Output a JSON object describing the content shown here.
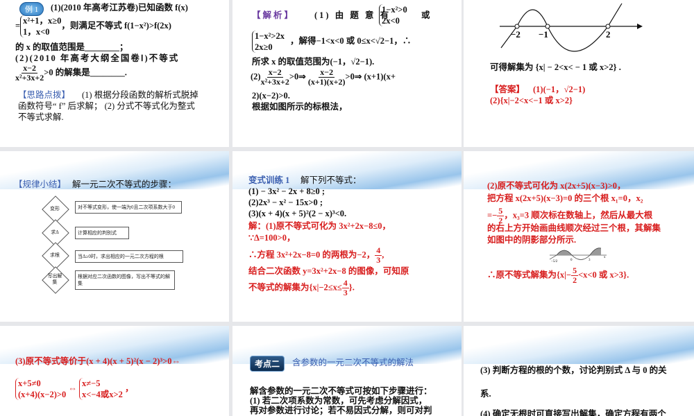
{
  "s1": {
    "badge": "例 1",
    "l1": "(1)(2010 年高考江苏卷)已知函数 f(x)",
    "eq": "=",
    "c1": "x²+1，x≥0",
    "c2": "1，x<0",
    "l2": "，则满足不等式 f(1−x²)>f(2x)",
    "l3": "的 x 的取值范围是________；",
    "l4": "(2)(2010 年高考大纲全国卷Ⅰ)不等式",
    "num": "x−2",
    "den": "x²+3x+2",
    "l5": ">0 的解集是________.",
    "tip": "【思路点拨】",
    "t1": "(1) 根据分段函数的解析式脱掉",
    "t2": "函数符号“ f” 后求解； (2) 分式不等式化为整式",
    "t3": "不等式求解."
  },
  "s2": {
    "tag": "【解析】",
    "l1": "(1) 由 题 意 有",
    "c1": "1−x²>0",
    "c2": "2x<0",
    "or": "或",
    "c3": "1−x²>2x",
    "c4": "2x≥0",
    "l2": "，解得−1<x<0 或 0≤x<√2−1，∴",
    "l3": "所求 x 的取值范围为(−1，√2−1).",
    "p2": "(2)",
    "n1": "x−2",
    "d1": "x²+3x+2",
    "a1": ">0⇒",
    "n2": "x−2",
    "d2": "(x+1)(x+2)",
    "a2": ">0⇒ (x+1)(x+",
    "l4": "2)(x−2)>0.",
    "l5": "根据如图所示的标根法，"
  },
  "s3": {
    "ticks": [
      "−2",
      "−1",
      "2"
    ],
    "l1": "可得解集为 {x| − 2<x< − 1 或 x>2} .",
    "ans": "【答案】",
    "a1": "(1)(−1，√2−1)",
    "a2": "(2){x|−2<x<−1 或 x>2}"
  },
  "s4": {
    "tag": "【规律小结】",
    "title": "解一元二次不等式的步骤：",
    "steps": [
      {
        "d": "变形",
        "b": "对不等式变形，使一端为0且二次项系数大于0"
      },
      {
        "d": "求Δ",
        "b": "计算相应的判别式"
      },
      {
        "d": "求根",
        "b": "当Δ≥0时，求出相应的一元二次方程的根"
      },
      {
        "d": "写出解集",
        "b": "根据对应二次函数的图像，写出不等式的解集"
      }
    ]
  },
  "s5": {
    "tag": "变式训练 1",
    "title": "解下列不等式：",
    "q1": "(1) − 3x² − 2x + 8≥0 ;",
    "q2": "(2)2x³ − x² − 15x>0 ;",
    "q3": "(3)(x + 4)(x + 5)²(2 − x)³<0.",
    "r1": "解：(1)原不等式可化为 3x²+2x−8≤0，",
    "r2": "∵Δ=100>0，",
    "r3": "∴方程 3x²+2x−8=0 的两根为−2，",
    "r3n": "4",
    "r3d": "3",
    "r4": "结合二次函数 y=3x²+2x−8 的图像，可知原",
    "r5": "不等式的解集为{x|−2≤x≤",
    "r5n": "4",
    "r5d": "3",
    "r5e": "}."
  },
  "s6": {
    "l1": "(2)原不等式可化为 x(2x+5)(x−3)>0，",
    "l2": "把方程 x(2x+5)(x−3)=0 的三个根 x₁=0，x₂",
    "l3a": "=−",
    "fn": "5",
    "fd": "2",
    "l3b": "，x₃=3 顺次标在数轴上，然后从最大根",
    "l4": "的右上方开始画曲线顺次经过三个根，其解集",
    "l5": "如图中的阴影部分所示.",
    "ticks": [
      "−5/2",
      "0",
      "3",
      "x"
    ],
    "l6": "∴原不等式解集为{x|−",
    "l6n": "5",
    "l6d": "2",
    "l6e": "<x<0 或 x>3}."
  },
  "s7": {
    "l1": "(3)原不等式等价于(x + 4)(x + 5)²(x − 2)³>0⇔",
    "c1": "x+5≠0",
    "c2": "(x+4)(x−2)>0",
    "iff": "⇔",
    "c3": "x≠−5",
    "c4": "x<−4或x>2",
    "comma": "，"
  },
  "s8": {
    "badge": "考点二",
    "title": "含参数的一元二次不等式的解法",
    "l1": "解含参数的一元二次不等式可按如下步骤进行：",
    "l2": "(1) 若二次项系数为常数，可先考虑分解因式，",
    "l3": "再对参数进行讨论；若不易因式分解，则可对判"
  },
  "s9": {
    "l1": "(3) 判断方程的根的个数，讨论判别式 Δ 与 0 的关",
    "l2": "系.",
    "l3": "(4) 确定无根时可直接写出解集，确定方程有两个"
  }
}
